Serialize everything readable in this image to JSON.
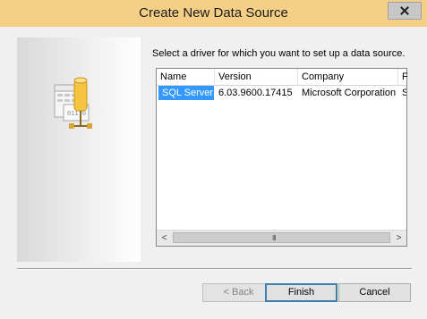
{
  "window": {
    "title": "Create New Data Source"
  },
  "instruction": "Select a driver for which you want to set up a data source.",
  "driver_list": {
    "columns": [
      "Name",
      "Version",
      "Company",
      "F"
    ],
    "rows": [
      {
        "name": "SQL Server",
        "version": "6.03.9600.17415",
        "company": "Microsoft Corporation",
        "file": "S",
        "selected": true
      }
    ]
  },
  "scrollbar": {
    "left_arrow": "<",
    "right_arrow": ">",
    "grip": "III"
  },
  "buttons": {
    "back": "< Back",
    "finish": "Finish",
    "cancel": "Cancel"
  },
  "art": {
    "file_text": "011 0"
  },
  "colors": {
    "title_bar": "#f6cf86",
    "selection": "#3399ff",
    "dialog_bg": "#f0f0f0"
  }
}
